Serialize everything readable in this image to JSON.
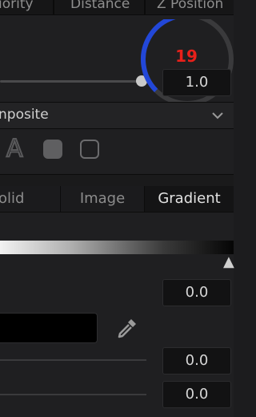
{
  "top_tabs": [
    "iority",
    "Distance",
    "Z Position"
  ],
  "dial": {
    "value": "19",
    "fraction": 0.55
  },
  "slider": {
    "value": "1.0"
  },
  "composite": {
    "title": "nposite"
  },
  "shape_buttons": [
    {
      "icon": "text-a-icon",
      "glyph": "A"
    },
    {
      "icon": "filled-rounded-square-icon"
    },
    {
      "icon": "outline-rounded-square-icon"
    }
  ],
  "fill_tabs": [
    "olid",
    "Image",
    "Gradient"
  ],
  "gradient": {
    "marker_glyph": "▲"
  },
  "fields": {
    "field_1": "0.0",
    "field_2": "0.0",
    "field_3": "0.0"
  },
  "colors": {
    "accent": "#2247d8",
    "dial_number": "#e8201a"
  }
}
